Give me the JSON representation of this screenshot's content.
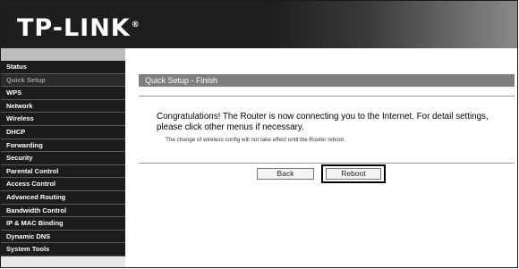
{
  "brand": {
    "logo_text": "TP-LINK",
    "registered_mark": "®"
  },
  "sidebar": {
    "items": [
      {
        "label": "Status"
      },
      {
        "label": "Quick Setup",
        "active": true
      },
      {
        "label": "WPS"
      },
      {
        "label": "Network"
      },
      {
        "label": "Wireless"
      },
      {
        "label": "DHCP"
      },
      {
        "label": "Forwarding"
      },
      {
        "label": "Security"
      },
      {
        "label": "Parental Control"
      },
      {
        "label": "Access Control"
      },
      {
        "label": "Advanced Routing"
      },
      {
        "label": "Bandwidth Control"
      },
      {
        "label": "IP & MAC Binding"
      },
      {
        "label": "Dynamic DNS"
      },
      {
        "label": "System Tools"
      }
    ]
  },
  "main": {
    "title": "Quick Setup - Finish",
    "message": "Congratulations! The Router is now connecting you to the Internet. For detail settings, please click other menus if necessary.",
    "note": "The change of wireless config will not take effect until the Router reboot.",
    "buttons": {
      "back_label": "Back",
      "reboot_label": "Reboot"
    }
  },
  "colors": {
    "header_bg": "#1e1e1e",
    "title_bar_bg": "#7f7f7f",
    "menu_bg": "#1c1c1c",
    "active_menu_text": "#9a9a9a"
  }
}
